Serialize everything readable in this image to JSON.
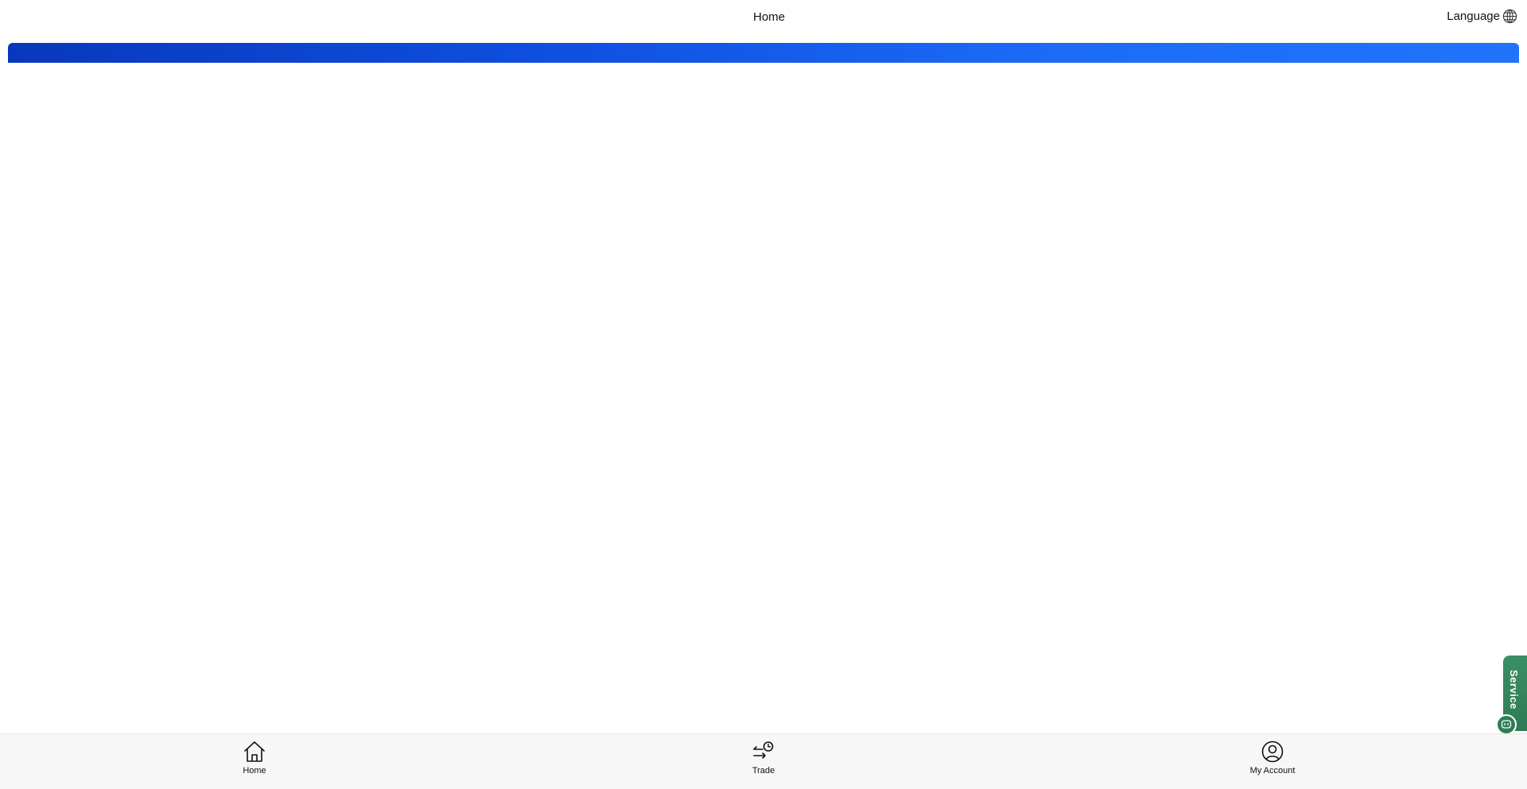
{
  "header": {
    "title": "Home",
    "language_label": "Language",
    "language_icon": "globe-icon"
  },
  "banner": {
    "gradient_start": "#0838bd",
    "gradient_end": "#2173fa"
  },
  "service": {
    "label": "Service",
    "color": "#2f7a55",
    "chat_icon": "chat-icon"
  },
  "bottom_nav": {
    "items": [
      {
        "label": "Home",
        "icon": "home-icon"
      },
      {
        "label": "Trade",
        "icon": "trade-icon"
      },
      {
        "label": "My Account",
        "icon": "account-icon"
      }
    ]
  }
}
